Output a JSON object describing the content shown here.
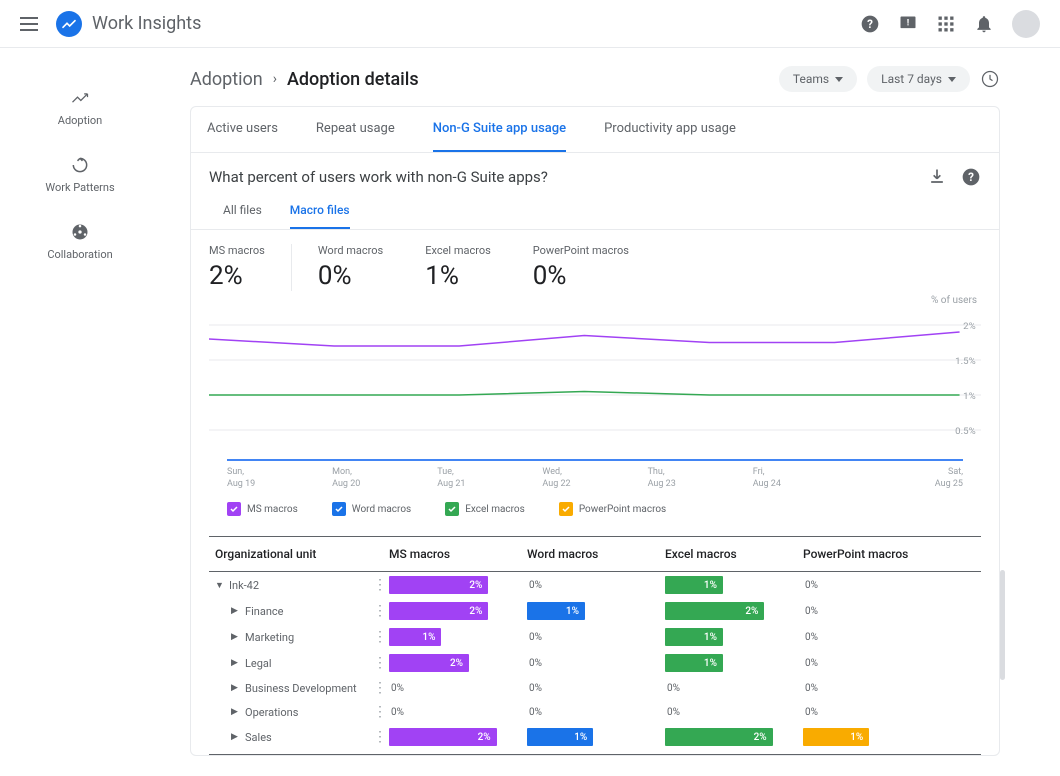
{
  "header": {
    "title": "Work Insights",
    "icons": [
      "help-icon",
      "feedback-icon",
      "apps-icon",
      "notifications-icon",
      "avatar"
    ]
  },
  "sidebar": {
    "items": [
      {
        "label": "Adoption",
        "icon": "trend-up-icon"
      },
      {
        "label": "Work Patterns",
        "icon": "refresh-icon"
      },
      {
        "label": "Collaboration",
        "icon": "collab-icon"
      }
    ]
  },
  "breadcrumb": {
    "crumb1": "Adoption",
    "crumb2": "Adoption details"
  },
  "controls": {
    "teams": "Teams",
    "range": "Last 7 days"
  },
  "tabs_primary": [
    {
      "label": "Active users"
    },
    {
      "label": "Repeat usage"
    },
    {
      "label": "Non-G Suite app usage",
      "active": true
    },
    {
      "label": "Productivity app usage"
    }
  ],
  "card": {
    "question": "What percent of users work with non-G Suite apps?",
    "tabs_secondary": [
      {
        "label": "All files"
      },
      {
        "label": "Macro files",
        "active": true
      }
    ],
    "stats": [
      {
        "label": "MS macros",
        "value": "2%"
      },
      {
        "label": "Word macros",
        "value": "0%"
      },
      {
        "label": "Excel macros",
        "value": "1%"
      },
      {
        "label": "PowerPoint macros",
        "value": "0%"
      }
    ],
    "ylabel": "% of users",
    "yticks": [
      "2%",
      "1.5%",
      "1%",
      "0.5%"
    ],
    "xaxis": [
      {
        "day": "Sun,",
        "date": "Aug 19"
      },
      {
        "day": "Mon,",
        "date": "Aug 20"
      },
      {
        "day": "Tue,",
        "date": "Aug 21"
      },
      {
        "day": "Wed,",
        "date": "Aug 22"
      },
      {
        "day": "Thu,",
        "date": "Aug 23"
      },
      {
        "day": "Fri,",
        "date": "Aug 24"
      },
      {
        "day": "Sat,",
        "date": "Aug 25"
      }
    ],
    "legend": [
      {
        "label": "MS macros",
        "color": "c-purple"
      },
      {
        "label": "Word macros",
        "color": "c-blue"
      },
      {
        "label": "Excel macros",
        "color": "c-green"
      },
      {
        "label": "PowerPoint macros",
        "color": "c-orange"
      }
    ],
    "table": {
      "headers": [
        "Organizational unit",
        "MS macros",
        "Word macros",
        "Excel macros",
        "PowerPoint macros"
      ],
      "rows": [
        {
          "indent": 0,
          "name": "Ink-42",
          "expanded": true,
          "ms": "2%",
          "msw": 72,
          "word": "0%",
          "wordw": 0,
          "excel": "1%",
          "excelw": 42,
          "pp": "0%",
          "ppw": 0
        },
        {
          "indent": 1,
          "name": "Finance",
          "ms": "2%",
          "msw": 72,
          "word": "1%",
          "wordw": 42,
          "excel": "2%",
          "excelw": 72,
          "pp": "0%",
          "ppw": 0
        },
        {
          "indent": 1,
          "name": "Marketing",
          "ms": "1%",
          "msw": 38,
          "word": "0%",
          "wordw": 0,
          "excel": "1%",
          "excelw": 42,
          "pp": "0%",
          "ppw": 0
        },
        {
          "indent": 1,
          "name": "Legal",
          "ms": "2%",
          "msw": 58,
          "word": "0%",
          "wordw": 0,
          "excel": "1%",
          "excelw": 42,
          "pp": "0%",
          "ppw": 0
        },
        {
          "indent": 1,
          "name": "Business Development",
          "ms": "0%",
          "msw": 0,
          "word": "0%",
          "wordw": 0,
          "excel": "0%",
          "excelw": 0,
          "pp": "0%",
          "ppw": 0
        },
        {
          "indent": 1,
          "name": "Operations",
          "ms": "0%",
          "msw": 0,
          "word": "0%",
          "wordw": 0,
          "excel": "0%",
          "excelw": 0,
          "pp": "0%",
          "ppw": 0
        },
        {
          "indent": 1,
          "name": "Sales",
          "ms": "2%",
          "msw": 78,
          "word": "1%",
          "wordw": 48,
          "excel": "2%",
          "excelw": 78,
          "pp": "1%",
          "ppw": 48
        }
      ]
    }
  },
  "chart_data": {
    "type": "line",
    "title": "What percent of users work with non-G Suite apps?",
    "ylabel": "% of users",
    "ylim": [
      0,
      2
    ],
    "x": [
      "Aug 19",
      "Aug 20",
      "Aug 21",
      "Aug 22",
      "Aug 23",
      "Aug 24",
      "Aug 25"
    ],
    "series": [
      {
        "name": "MS macros",
        "color": "#a142f4",
        "values": [
          1.8,
          1.7,
          1.7,
          1.85,
          1.75,
          1.75,
          1.9
        ]
      },
      {
        "name": "Word macros",
        "color": "#1a73e8",
        "values": [
          0,
          0,
          0,
          0,
          0,
          0,
          0
        ]
      },
      {
        "name": "Excel macros",
        "color": "#34a853",
        "values": [
          1.0,
          1.0,
          1.0,
          1.05,
          1.0,
          1.0,
          1.0
        ]
      },
      {
        "name": "PowerPoint macros",
        "color": "#f9ab00",
        "values": [
          0,
          0,
          0,
          0,
          0,
          0,
          0
        ]
      }
    ]
  }
}
